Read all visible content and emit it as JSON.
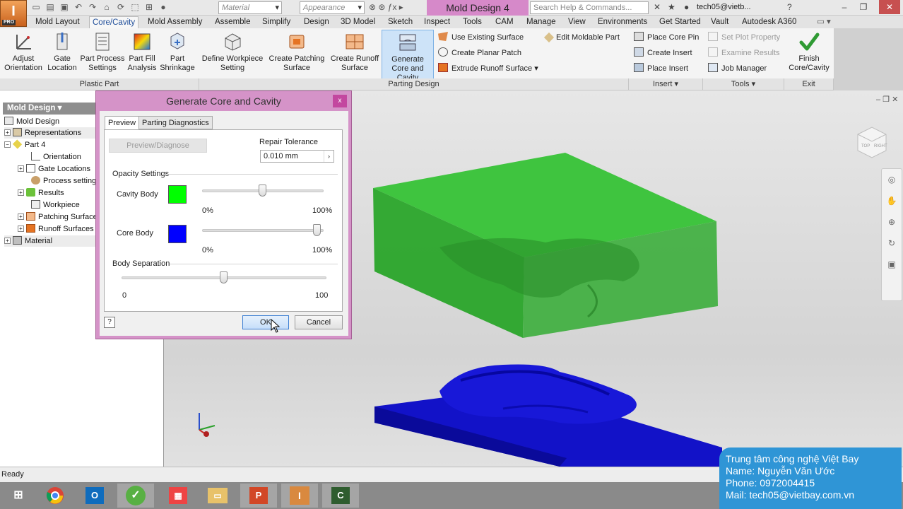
{
  "app": {
    "logo_text": "I",
    "edition": "PRO",
    "document_title": "Mold Design 4"
  },
  "quick_access": {
    "material_combo": "Material",
    "appearance_combo": "Appearance",
    "search_placeholder": "Search Help & Commands...",
    "user": "tech05@vietb..."
  },
  "ribbon_tabs": [
    "Mold Layout",
    "Core/Cavity",
    "Mold Assembly",
    "Assemble",
    "Simplify",
    "Design",
    "3D Model",
    "Sketch",
    "Inspect",
    "Tools",
    "CAM",
    "Manage",
    "View",
    "Environments",
    "Get Started",
    "Vault",
    "Autodesk A360"
  ],
  "active_tab": "Core/Cavity",
  "ribbon": {
    "plastic_part": {
      "label": "Plastic Part",
      "buttons": [
        "Adjust Orientation",
        "Gate Location",
        "Part Process Settings",
        "Part Fill Analysis",
        "Part Shrinkage"
      ]
    },
    "parting_design": {
      "label": "Parting Design",
      "buttons": [
        "Define Workpiece Setting",
        "Create Patching Surface",
        "Create Runoff Surface",
        "Generate Core and Cavity"
      ],
      "small": [
        "Use Existing Surface",
        "Create Planar Patch",
        "Extrude Runoff Surface",
        "Edit Moldable Part"
      ]
    },
    "insert": {
      "label": "Insert",
      "items": [
        "Place Core Pin",
        "Create Insert",
        "Place Insert"
      ]
    },
    "tools": {
      "label": "Tools",
      "items": [
        "Set Plot Property",
        "Examine Results",
        "Job Manager"
      ]
    },
    "exit": {
      "label": "Exit",
      "button": "Finish Core/Cavity"
    }
  },
  "browser": {
    "header": "Mold Design",
    "items": [
      "Mold Design",
      "Representations",
      "Part 4",
      "Orientation",
      "Gate Locations",
      "Process settings",
      "Results",
      "Workpiece",
      "Patching Surfaces",
      "Runoff Surfaces",
      "Material"
    ]
  },
  "dialog": {
    "title": "Generate Core and Cavity",
    "close": "x",
    "tabs": [
      "Preview",
      "Parting Diagnostics"
    ],
    "preview_button": "Preview/Diagnose",
    "repair_tolerance_label": "Repair Tolerance",
    "repair_tolerance_value": "0.010 mm",
    "opacity_label": "Opacity Settings",
    "cavity_label": "Cavity Body",
    "core_label": "Core Body",
    "cavity_color": "#00ff00",
    "core_color": "#0000ff",
    "cavity_opacity": 0.5,
    "core_opacity": 0.95,
    "min_pct": "0%",
    "max_pct": "100%",
    "separation_label": "Body Separation",
    "separation_min": "0",
    "separation_max": "100",
    "separation_value": 50,
    "ok": "OK",
    "cancel": "Cancel",
    "help": "?"
  },
  "status": "Ready",
  "watermark": {
    "line1": "Trung tâm công nghệ Việt Bay",
    "line2": "Name: Nguyễn Văn Ước",
    "line3": "Phone: 0972004415",
    "line4": "Mail: tech05@vietbay.com.vn"
  },
  "colors": {
    "accent": "#1f4e9a",
    "dialog_frame": "#d593c8",
    "doc_title": "#d689c9",
    "watermark": "#2f95d6"
  },
  "taskbar": [
    "windows-start",
    "chrome",
    "outlook",
    "green-app",
    "network-app",
    "file-explorer",
    "powerpoint",
    "inventor",
    "camtasia"
  ],
  "viewcube_labels": [
    "TOP",
    "RIGHT"
  ]
}
